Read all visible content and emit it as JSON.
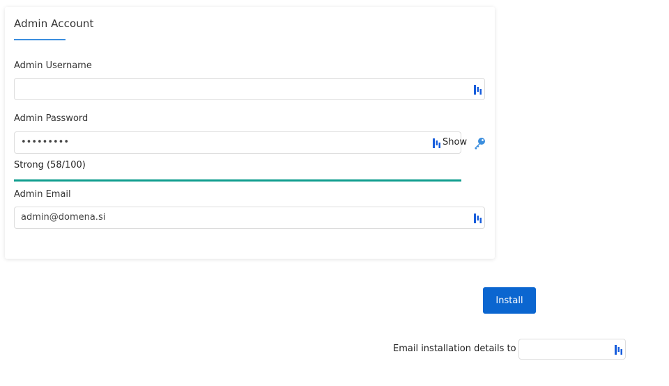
{
  "card": {
    "title": "Admin Account"
  },
  "username": {
    "label": "Admin Username",
    "value": ""
  },
  "password": {
    "label": "Admin Password",
    "value": "•••••••••",
    "show_label": "Show"
  },
  "strength": {
    "text": "Strong (58/100)",
    "score": 58,
    "color": "#0f9d8e"
  },
  "email": {
    "label": "Admin Email",
    "value": "admin@domena.si"
  },
  "install": {
    "label": "Install"
  },
  "email_details": {
    "label": "Email installation details to :",
    "value": ""
  },
  "colors": {
    "accent": "#3b8ede",
    "button": "#0b66d0",
    "bitwarden_icon": "#175ddc"
  },
  "icons": {
    "field_autofill": "bitwarden-icon",
    "password_generator": "key-icon"
  }
}
